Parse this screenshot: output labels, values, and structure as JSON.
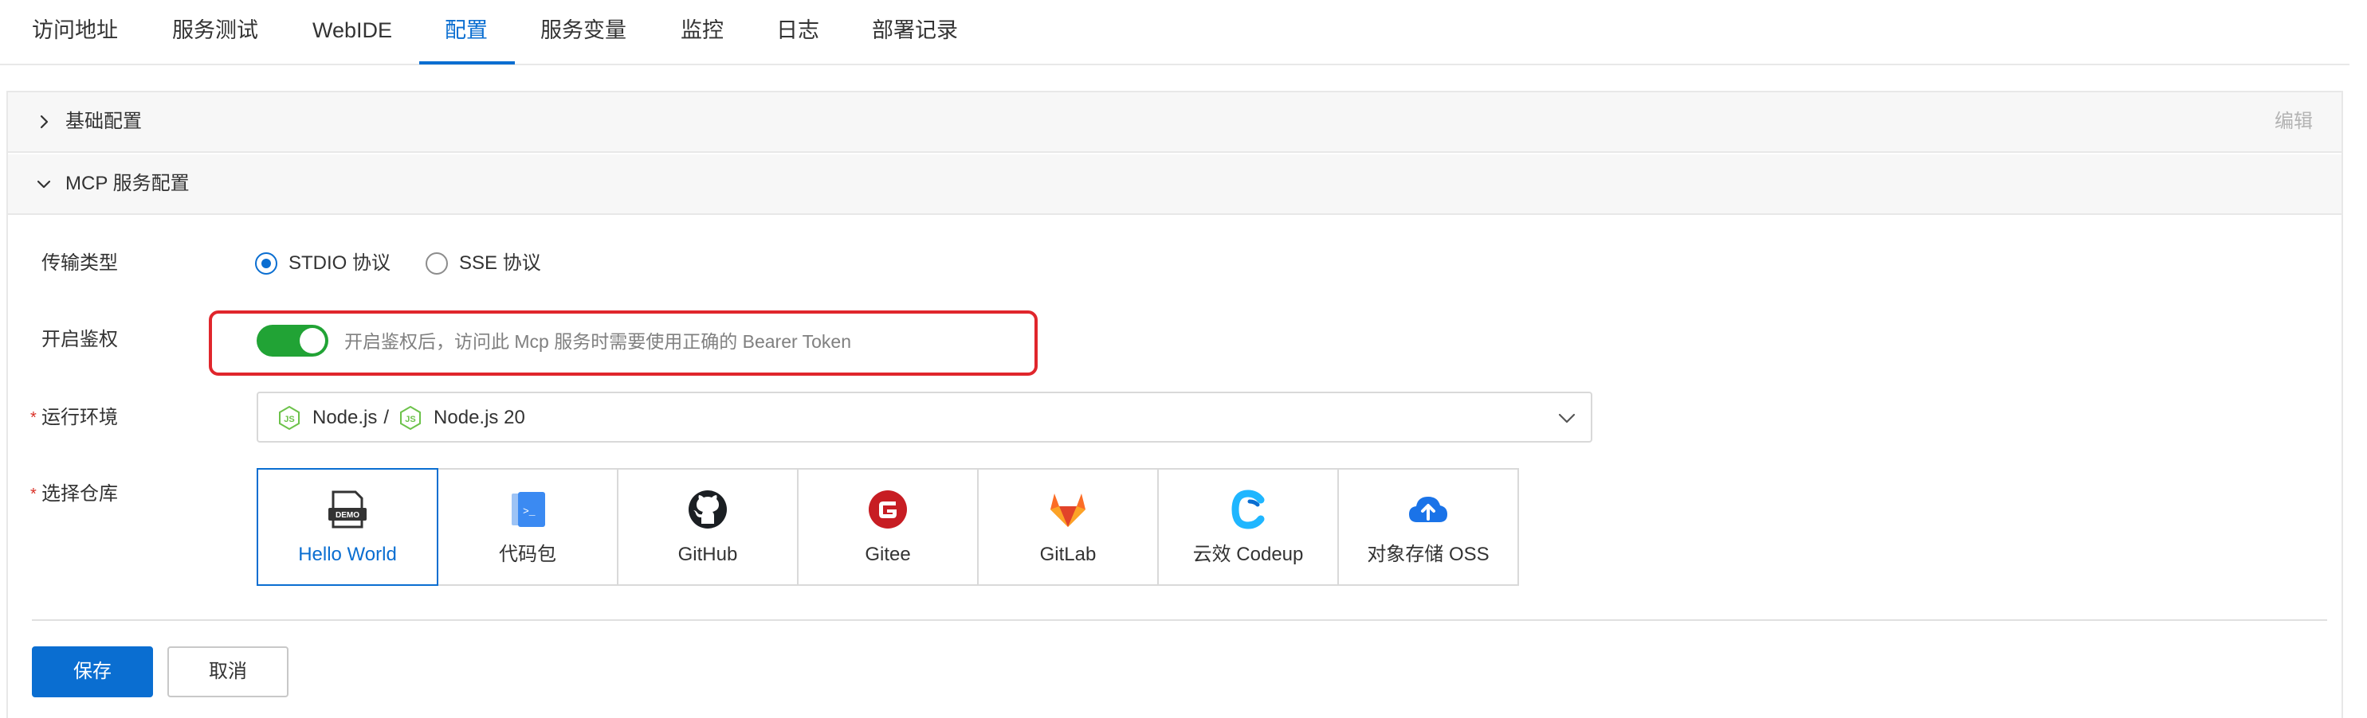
{
  "tabs": [
    {
      "label": "访问地址"
    },
    {
      "label": "服务测试"
    },
    {
      "label": "WebIDE"
    },
    {
      "label": "配置"
    },
    {
      "label": "服务变量"
    },
    {
      "label": "监控"
    },
    {
      "label": "日志"
    },
    {
      "label": "部署记录"
    }
  ],
  "active_tab": "配置",
  "sections": {
    "basic": {
      "title": "基础配置",
      "edit_label": "编辑",
      "expanded": false
    },
    "mcp": {
      "title": "MCP 服务配置",
      "expanded": true
    }
  },
  "form": {
    "transport": {
      "label": "传输类型",
      "options": [
        "STDIO 协议",
        "SSE 协议"
      ],
      "selected": "STDIO 协议"
    },
    "auth": {
      "label": "开启鉴权",
      "enabled": true,
      "hint": "开启鉴权后，访问此 Mcp 服务时需要使用正确的 Bearer Token"
    },
    "runtime": {
      "label": "运行环境",
      "required": true,
      "value_part1": "Node.js",
      "separator": "/",
      "value_part2": "Node.js 20"
    },
    "repo": {
      "label": "选择仓库",
      "required": true,
      "options": [
        {
          "label": "Hello World",
          "icon": "demo-icon"
        },
        {
          "label": "代码包",
          "icon": "code-package-icon"
        },
        {
          "label": "GitHub",
          "icon": "github-icon"
        },
        {
          "label": "Gitee",
          "icon": "gitee-icon"
        },
        {
          "label": "GitLab",
          "icon": "gitlab-icon"
        },
        {
          "label": "云效 Codeup",
          "icon": "codeup-icon"
        },
        {
          "label": "对象存储 OSS",
          "icon": "oss-icon"
        }
      ],
      "selected": "Hello World"
    }
  },
  "actions": {
    "save_label": "保存",
    "cancel_label": "取消"
  },
  "colors": {
    "accent": "#0a6ed1",
    "switch_on": "#21a335",
    "highlight": "#e0262c"
  }
}
